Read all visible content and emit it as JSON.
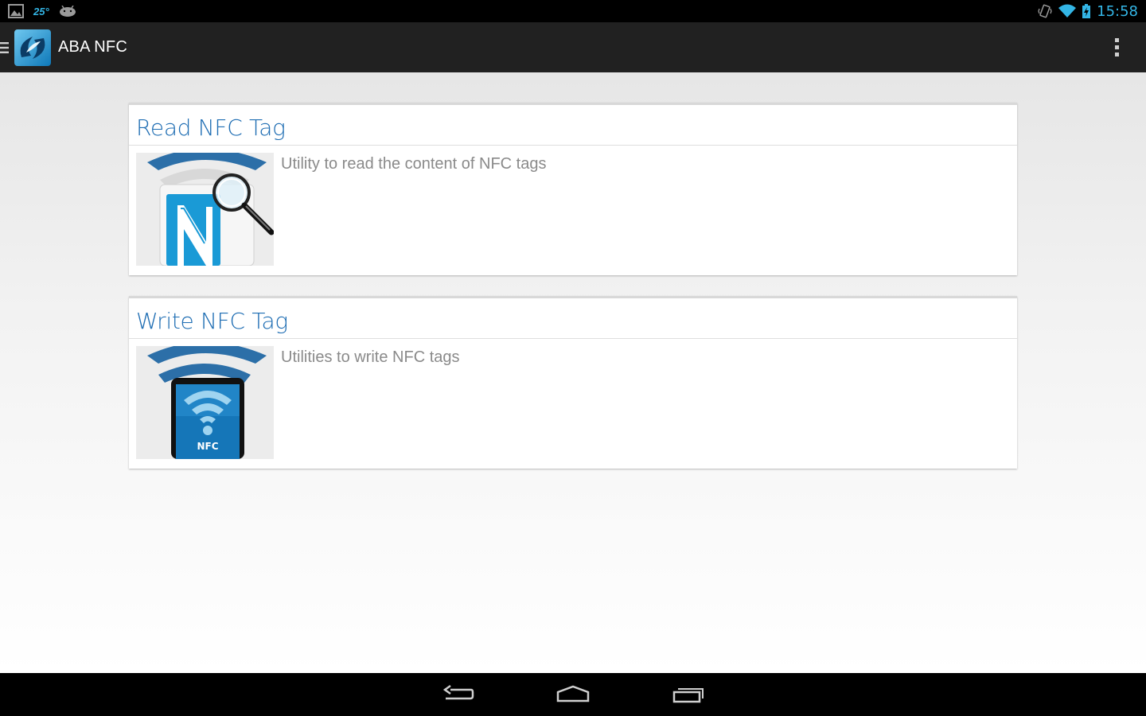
{
  "status_bar": {
    "left_icons": [
      "gallery-icon",
      "weather-icon",
      "android-icon"
    ],
    "temperature": "25°",
    "right_icons": [
      "vibrate-icon",
      "wifi-icon",
      "battery-charging-icon"
    ],
    "time": "15:58"
  },
  "action_bar": {
    "title": "ABA NFC",
    "menu_icon": "drawer-icon",
    "overflow_icon": "overflow-menu-icon"
  },
  "cards": [
    {
      "title": "Read NFC Tag",
      "description": "Utility to read the content of NFC tags",
      "image": "nfc-read-icon"
    },
    {
      "title": "Write NFC Tag",
      "description": "Utilities to write NFC tags",
      "image": "nfc-write-icon"
    }
  ],
  "nav_bar": {
    "buttons": [
      "back-icon",
      "home-icon",
      "recent-apps-icon"
    ]
  },
  "colors": {
    "accent": "#33b5e5",
    "title_blue": "#1e6db3",
    "action_bar": "#212121",
    "nfc_blue": "#1a9ad6"
  }
}
